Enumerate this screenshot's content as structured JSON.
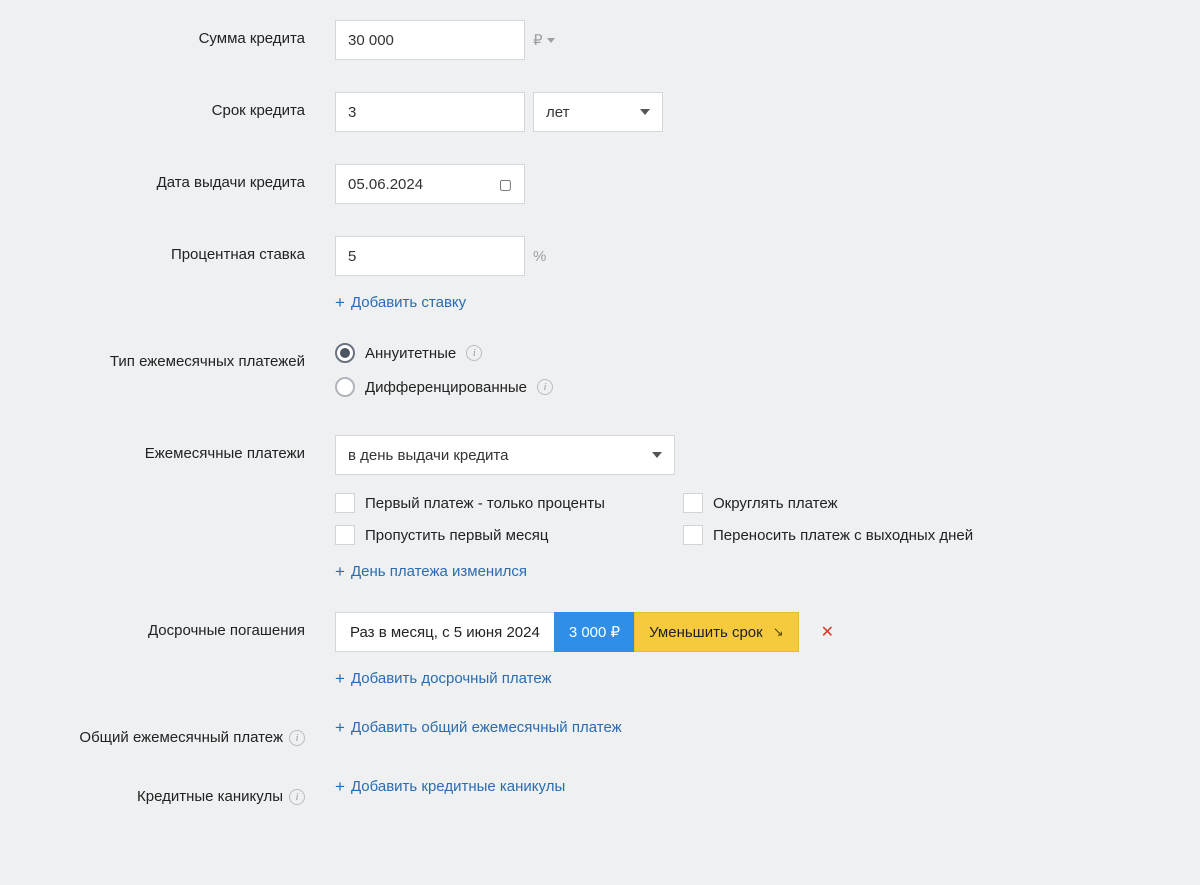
{
  "labels": {
    "amount": "Сумма кредита",
    "term": "Срок кредита",
    "issue_date": "Дата выдачи кредита",
    "rate": "Процентная ставка",
    "payment_type": "Тип ежемесячных платежей",
    "monthly": "Ежемесячные платежи",
    "early": "Досрочные погашения",
    "total_monthly": "Общий ежемесячный платеж",
    "holidays": "Кредитные каникулы"
  },
  "fields": {
    "amount": "30 000",
    "currency_symbol": "₽",
    "term_value": "3",
    "term_unit": "лет",
    "issue_date": "05.06.2024",
    "rate_value": "5",
    "rate_unit": "%",
    "add_rate": "Добавить ставку"
  },
  "payment_type": {
    "annuity": "Аннуитетные",
    "differentiated": "Дифференцированные",
    "selected": "annuity"
  },
  "monthly": {
    "schedule_option": "в день выдачи кредита",
    "checkboxes": {
      "first_interest_only": "Первый платеж - только проценты",
      "round_payment": "Округлять платеж",
      "skip_first_month": "Пропустить первый месяц",
      "move_from_weekend": "Переносить платеж с выходных дней"
    },
    "change_day_link": "День платежа изменился"
  },
  "early": {
    "schedule": "Раз в месяц, с 5 июня 2024",
    "amount": "3 000 ₽",
    "action": "Уменьшить срок",
    "add_link": "Добавить досрочный платеж"
  },
  "total_monthly_link": "Добавить общий ежемесячный платеж",
  "holidays_link": "Добавить кредитные каникулы"
}
